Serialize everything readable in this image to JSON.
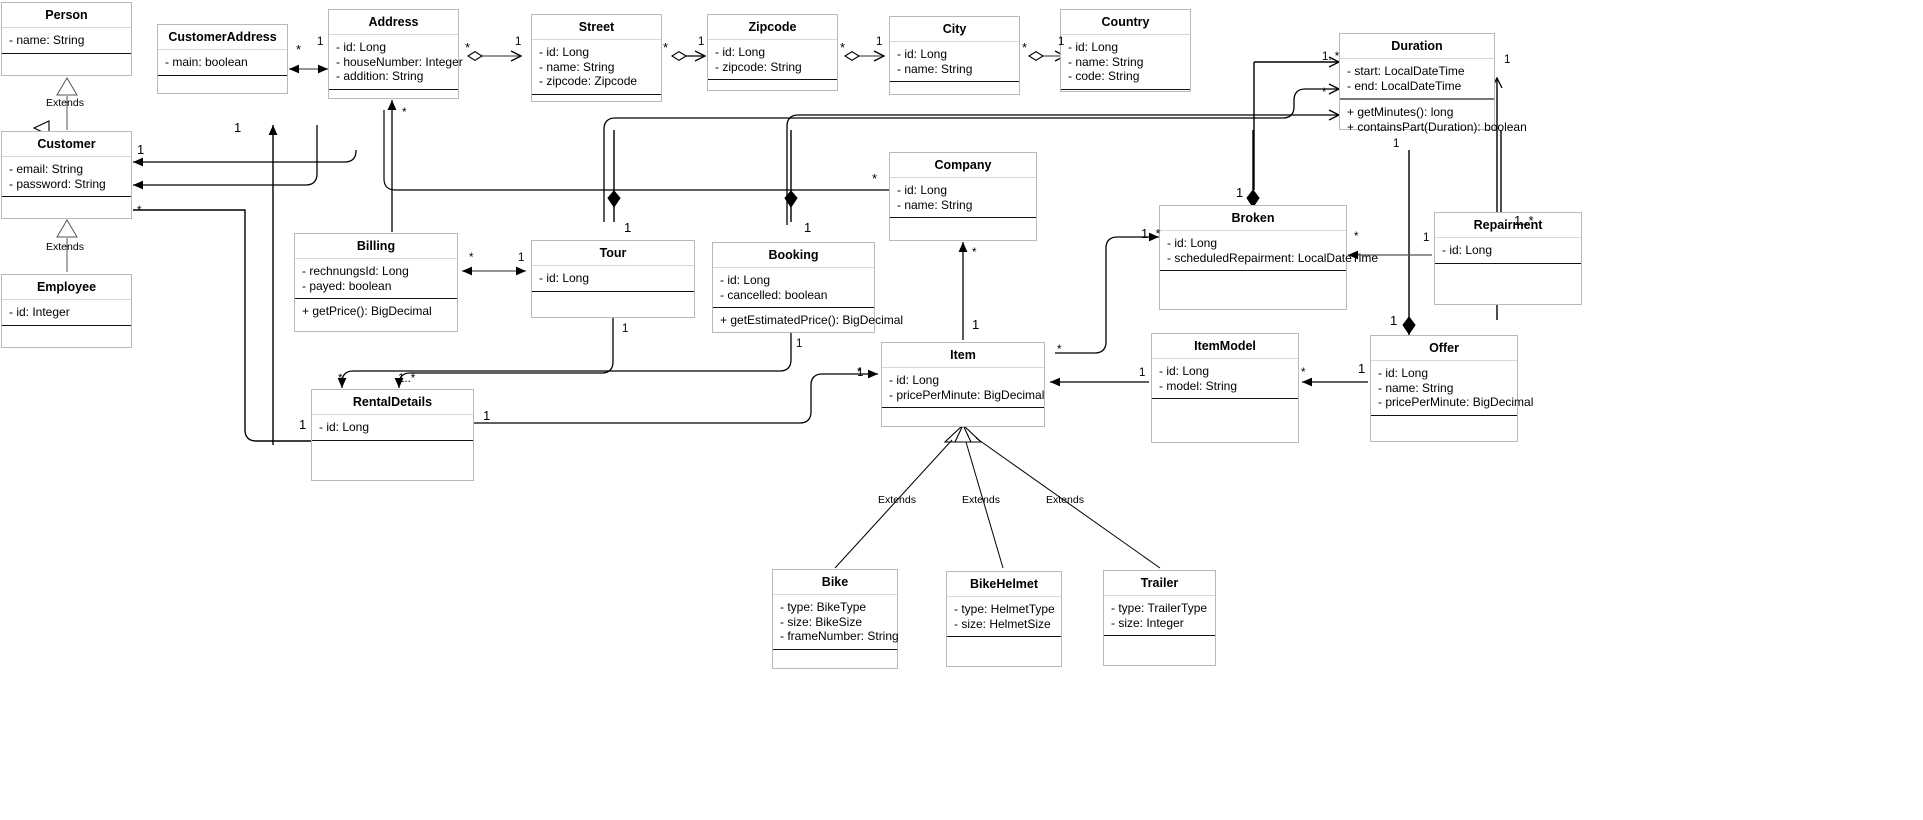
{
  "diagram": {
    "title": "UML Class Diagram - Bike Rental Domain Model",
    "type": "uml-class-diagram",
    "stroke_color": "#000000",
    "box_border_color": "#b9b9b9",
    "background": "#ffffff"
  },
  "classes": [
    {
      "id": "person",
      "name": "Person",
      "attributes": [
        "- name: String"
      ],
      "operations": []
    },
    {
      "id": "customer",
      "name": "Customer",
      "attributes": [
        "- email: String",
        "- password: String"
      ],
      "operations": []
    },
    {
      "id": "employee",
      "name": "Employee",
      "attributes": [
        "- id: Integer"
      ],
      "operations": []
    },
    {
      "id": "customeraddress",
      "name": "CustomerAddress",
      "attributes": [
        "- main: boolean"
      ],
      "operations": []
    },
    {
      "id": "address",
      "name": "Address",
      "attributes": [
        "- id: Long",
        "- houseNumber: Integer",
        "- addition: String"
      ],
      "operations": []
    },
    {
      "id": "street",
      "name": "Street",
      "attributes": [
        "- id: Long",
        "- name: String",
        "- zipcode: Zipcode"
      ],
      "operations": []
    },
    {
      "id": "zipcode",
      "name": "Zipcode",
      "attributes": [
        "- id: Long",
        "- zipcode: String"
      ],
      "operations": []
    },
    {
      "id": "city",
      "name": "City",
      "attributes": [
        "- id: Long",
        "- name: String"
      ],
      "operations": []
    },
    {
      "id": "country",
      "name": "Country",
      "attributes": [
        "- id: Long",
        "- name: String",
        "- code: String"
      ],
      "operations": []
    },
    {
      "id": "duration",
      "name": "Duration",
      "attributes": [
        "- start: LocalDateTime",
        "- end: LocalDateTime"
      ],
      "operations": [
        "+ getMinutes(): long",
        "+ containsPart(Duration): boolean"
      ]
    },
    {
      "id": "company",
      "name": "Company",
      "attributes": [
        "- id: Long",
        "- name: String"
      ],
      "operations": []
    },
    {
      "id": "broken",
      "name": "Broken",
      "attributes": [
        "- id: Long",
        "- scheduledRepairment: LocalDateTime"
      ],
      "operations": []
    },
    {
      "id": "repairment",
      "name": "Repairment",
      "attributes": [
        "- id: Long"
      ],
      "operations": []
    },
    {
      "id": "billing",
      "name": "Billing",
      "attributes": [
        "- rechnungsId: Long",
        "- payed: boolean"
      ],
      "operations": [
        "+ getPrice(): BigDecimal"
      ]
    },
    {
      "id": "tour",
      "name": "Tour",
      "attributes": [
        "- id: Long"
      ],
      "operations": []
    },
    {
      "id": "booking",
      "name": "Booking",
      "attributes": [
        "- id: Long",
        "- cancelled: boolean"
      ],
      "operations": [
        "+ getEstimatedPrice(): BigDecimal"
      ]
    },
    {
      "id": "item",
      "name": "Item",
      "attributes": [
        "- id: Long",
        "- pricePerMinute: BigDecimal"
      ],
      "operations": []
    },
    {
      "id": "itemmodel",
      "name": "ItemModel",
      "attributes": [
        "- id: Long",
        "- model: String"
      ],
      "operations": []
    },
    {
      "id": "offer",
      "name": "Offer",
      "attributes": [
        "- id: Long",
        "- name: String",
        "- pricePerMinute: BigDecimal"
      ],
      "operations": []
    },
    {
      "id": "rentaldetails",
      "name": "RentalDetails",
      "attributes": [
        "- id: Long"
      ],
      "operations": []
    },
    {
      "id": "bike",
      "name": "Bike",
      "attributes": [
        "- type: BikeType",
        "- size: BikeSize",
        "- frameNumber: String"
      ],
      "operations": []
    },
    {
      "id": "bikehelmet",
      "name": "BikeHelmet",
      "attributes": [
        "- type: HelmetType",
        "- size: HelmetSize"
      ],
      "operations": []
    },
    {
      "id": "trailer",
      "name": "Trailer",
      "attributes": [
        "- type: TrailerType",
        "- size: Integer"
      ],
      "operations": []
    }
  ],
  "labels": {
    "extends": "Extends",
    "one": "1",
    "star": "*",
    "one_or_more": "1..*"
  },
  "edge_labels": [
    {
      "id": "l1",
      "text": "Extends"
    },
    {
      "id": "l2",
      "text": "Extends"
    },
    {
      "id": "l3",
      "text": "Extends"
    },
    {
      "id": "l4",
      "text": "Extends"
    },
    {
      "id": "l5",
      "text": "Extends"
    },
    {
      "id": "m1",
      "text": "*"
    },
    {
      "id": "m2",
      "text": "1"
    },
    {
      "id": "m3",
      "text": "*"
    },
    {
      "id": "m4",
      "text": "1"
    },
    {
      "id": "m5",
      "text": "*"
    },
    {
      "id": "m6",
      "text": "1"
    },
    {
      "id": "m7",
      "text": "*"
    },
    {
      "id": "m8",
      "text": "1"
    },
    {
      "id": "m9",
      "text": "*"
    },
    {
      "id": "m10",
      "text": "1"
    },
    {
      "id": "m11",
      "text": "1..*"
    },
    {
      "id": "m12",
      "text": "*"
    },
    {
      "id": "m13",
      "text": "1"
    },
    {
      "id": "m14",
      "text": "1"
    },
    {
      "id": "m15",
      "text": "1"
    },
    {
      "id": "m16",
      "text": "1"
    },
    {
      "id": "m17",
      "text": "*"
    },
    {
      "id": "m18",
      "text": "*"
    },
    {
      "id": "m19",
      "text": "*"
    },
    {
      "id": "m20",
      "text": "*"
    },
    {
      "id": "m21",
      "text": "1"
    },
    {
      "id": "m22",
      "text": "1"
    },
    {
      "id": "m23",
      "text": "1"
    },
    {
      "id": "m24",
      "text": "1..*"
    },
    {
      "id": "m25",
      "text": "1"
    },
    {
      "id": "m26",
      "text": "*"
    },
    {
      "id": "m27",
      "text": "1"
    },
    {
      "id": "m28",
      "text": "1..*"
    },
    {
      "id": "m29",
      "text": "*"
    },
    {
      "id": "m30",
      "text": "1"
    },
    {
      "id": "m31",
      "text": "1"
    },
    {
      "id": "m32",
      "text": "1"
    },
    {
      "id": "m33",
      "text": "*"
    },
    {
      "id": "m34",
      "text": "1..*"
    },
    {
      "id": "m35",
      "text": "*"
    },
    {
      "id": "m36",
      "text": "*"
    },
    {
      "id": "m37",
      "text": "1"
    },
    {
      "id": "m38",
      "text": "1"
    }
  ]
}
